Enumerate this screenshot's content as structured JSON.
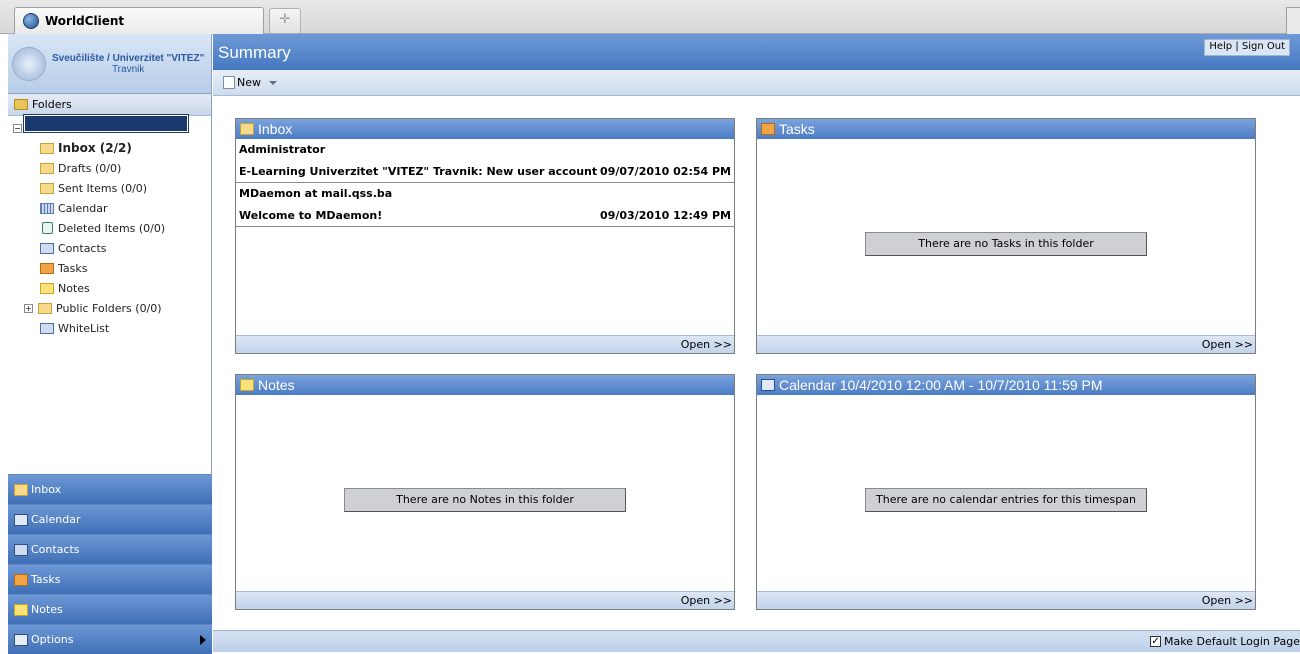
{
  "browser": {
    "tab_title": "WorldClient",
    "new_tab_symbol": "✛"
  },
  "logo": {
    "line1": "Sveučilište / Univerzitet \"VITEZ\"",
    "line2": "Travnik"
  },
  "folders": {
    "header": "Folders",
    "items": [
      {
        "label": "Inbox (2/2)",
        "icon": "envelope-icon",
        "bold": true
      },
      {
        "label": "Drafts (0/0)",
        "icon": "envelope-icon"
      },
      {
        "label": "Sent Items (0/0)",
        "icon": "envelope-icon"
      },
      {
        "label": "Calendar",
        "icon": "calendar-icon"
      },
      {
        "label": "Deleted Items (0/0)",
        "icon": "trash-icon"
      },
      {
        "label": "Contacts",
        "icon": "address-book-icon"
      },
      {
        "label": "Tasks",
        "icon": "tasks-icon"
      },
      {
        "label": "Notes",
        "icon": "note-icon"
      },
      {
        "label": "Public Folders (0/0)",
        "icon": "envelope-icon"
      },
      {
        "label": "WhiteList",
        "icon": "address-book-icon"
      }
    ]
  },
  "nav": {
    "inbox": "Inbox",
    "calendar": "Calendar",
    "contacts": "Contacts",
    "tasks": "Tasks",
    "notes": "Notes",
    "options": "Options"
  },
  "header": {
    "title": "Summary",
    "help": "Help",
    "separator": "|",
    "sign_out": "Sign Out"
  },
  "toolbar": {
    "new_label": "New"
  },
  "panels": {
    "inbox": {
      "title": "Inbox",
      "open": "Open >>",
      "messages": [
        {
          "from": "Administrator",
          "subject": "E-Learning Univerzitet \"VITEZ\" Travnik: New user account",
          "date": "09/07/2010 02:54 PM"
        },
        {
          "from": "MDaemon at mail.qss.ba",
          "subject": "Welcome to MDaemon!",
          "date": "09/03/2010 12:49 PM"
        }
      ]
    },
    "tasks": {
      "title": "Tasks",
      "empty": "There are no Tasks in this folder",
      "open": "Open >>"
    },
    "notes": {
      "title": "Notes",
      "empty": "There are no Notes in this folder",
      "open": "Open >>"
    },
    "calendar": {
      "title": "Calendar 10/4/2010 12:00 AM - 10/7/2010 11:59 PM",
      "empty": "There are no calendar entries for this timespan",
      "open": "Open >>"
    }
  },
  "status": {
    "default_login_label": "Make Default Login Page",
    "default_login_checked": true,
    "check_mark": "✓"
  }
}
